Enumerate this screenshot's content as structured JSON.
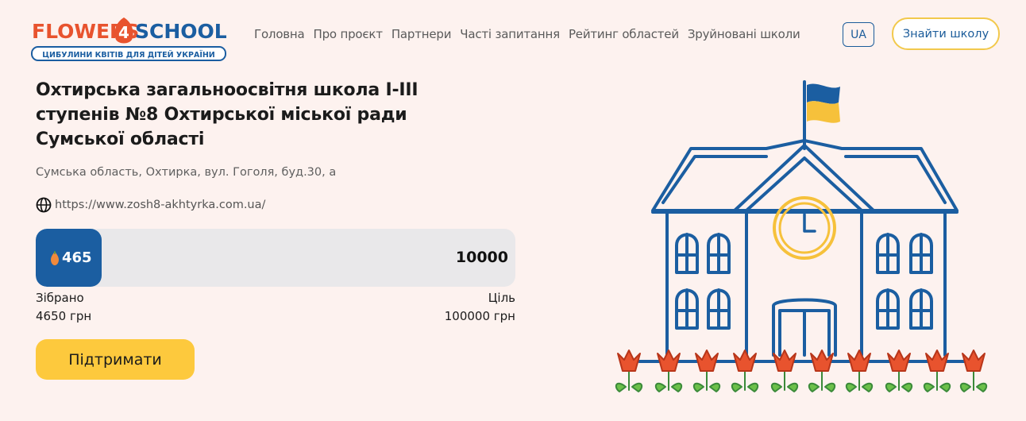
{
  "header": {
    "logo_title": "FLOWERS4SCHOOL",
    "logo_subtitle": "ЦИБУЛИНИ КВІТІВ ДЛЯ ДІТЕЙ УКРАЇНИ",
    "nav": [
      "Головна",
      "Про проєкт",
      "Партнери",
      "Часті запитання",
      "Рейтинг областей",
      "Зруйновані школи"
    ],
    "lang": "UA",
    "find_school": "Знайти школу"
  },
  "school": {
    "title": "Охтирська загальноосвітня школа І-ІІІ ступенів №8 Охтирської міської ради Сумської області",
    "address": "Сумська область, Охтирка, вул. Гоголя, буд.30, а",
    "website": "https://www.zosh8-akhtyrka.com.ua/"
  },
  "progress": {
    "collected_count": "465",
    "goal_count": "10000",
    "fraction": 0.0465,
    "collected_label": "Зібрано",
    "collected_amount": "4650 грн",
    "goal_label": "Ціль",
    "goal_amount": "100000 грн"
  },
  "support_button": "Підтримати",
  "colors": {
    "blue": "#1b5ea1",
    "yellow": "#fdc93d",
    "background": "#fdf2ef"
  }
}
